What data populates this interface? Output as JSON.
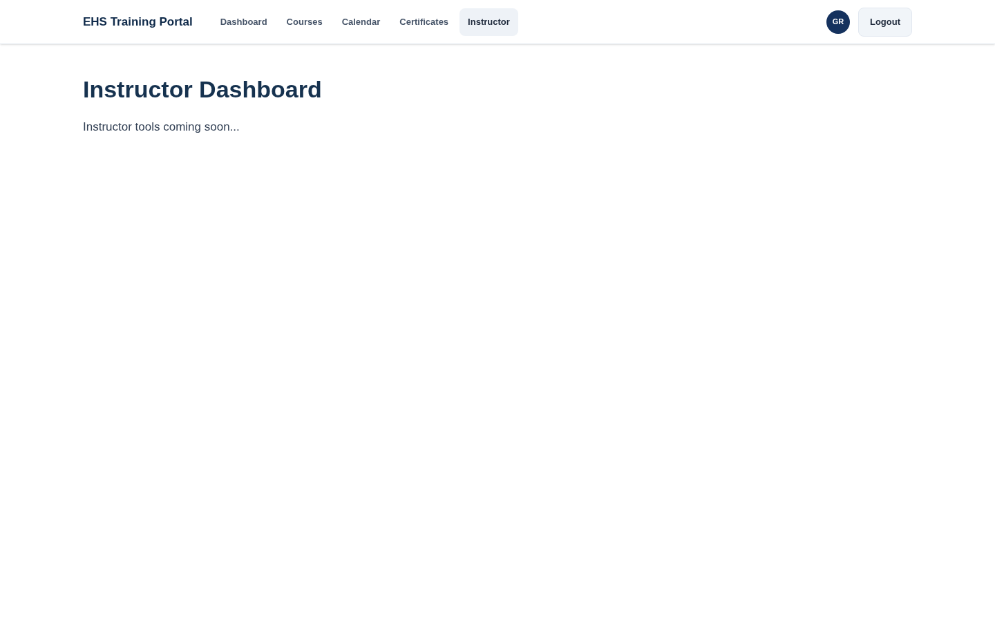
{
  "brand": "EHS Training Portal",
  "nav": [
    {
      "label": "Dashboard",
      "selected": false
    },
    {
      "label": "Courses",
      "selected": false
    },
    {
      "label": "Calendar",
      "selected": false
    },
    {
      "label": "Certificates",
      "selected": false
    },
    {
      "label": "Instructor",
      "selected": true
    }
  ],
  "user": {
    "initials": "GR"
  },
  "logout": "Logout",
  "page": {
    "title": "Instructor Dashboard",
    "message": "Instructor tools coming soon..."
  }
}
